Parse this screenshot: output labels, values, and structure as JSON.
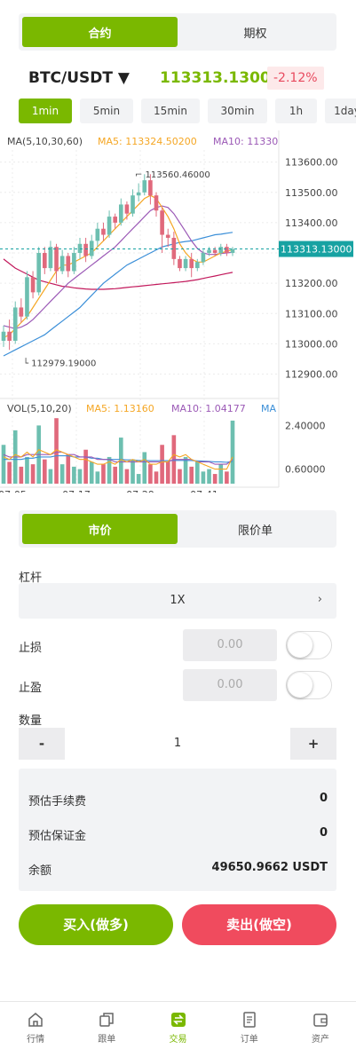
{
  "top_tabs": [
    "合约",
    "期权"
  ],
  "pair": {
    "symbol": "BTC/USDT ▼",
    "price": "113313.13000",
    "change": "-2.12%"
  },
  "timeframes": [
    "1min",
    "5min",
    "15min",
    "30min",
    "1h",
    "1day"
  ],
  "colors": {
    "accent": "#7ab800",
    "down": "#f04b5e",
    "up_candle": "#6dbfb0",
    "down_candle": "#e0697c",
    "ma5": "#f5a623",
    "ma10": "#9b59b6",
    "ma30": "#3b8fd8",
    "ma60": "#c2185b"
  },
  "chart_data": [
    {
      "type": "candlestick",
      "legend": {
        "label": "MA(5,10,30,60)",
        "ma5": "MA5: 113324.50200",
        "ma10": "MA10: 11330"
      },
      "y_ticks": [
        "113600.00",
        "113500.00",
        "113400.00",
        "113300.00",
        "113200.00",
        "113100.00",
        "113000.00",
        "112900.00"
      ],
      "ylim": [
        112840,
        113640
      ],
      "current_price_label": "113313.13000",
      "high_annotation": "113560.46000",
      "low_annotation": "112979.19000",
      "x_ticks": [
        "07:05",
        "07:17",
        "07:29",
        "07:41"
      ],
      "candles": [
        [
          113010,
          113040,
          112990,
          113060
        ],
        [
          113040,
          113010,
          112980,
          113080
        ],
        [
          113010,
          113120,
          113000,
          113140
        ],
        [
          113120,
          113090,
          113070,
          113150
        ],
        [
          113090,
          113220,
          113080,
          113240
        ],
        [
          113220,
          113170,
          113150,
          113240
        ],
        [
          113170,
          113300,
          113160,
          113320
        ],
        [
          113300,
          113250,
          113230,
          113320
        ],
        [
          113250,
          113320,
          113240,
          113340
        ],
        [
          113320,
          113240,
          113200,
          113330
        ],
        [
          113240,
          113290,
          113230,
          113310
        ],
        [
          113290,
          113240,
          113220,
          113300
        ],
        [
          113240,
          113300,
          113230,
          113320
        ],
        [
          113300,
          113330,
          113280,
          113350
        ],
        [
          113330,
          113290,
          113270,
          113350
        ],
        [
          113290,
          113340,
          113280,
          113360
        ],
        [
          113340,
          113380,
          113320,
          113400
        ],
        [
          113380,
          113360,
          113340,
          113400
        ],
        [
          113360,
          113420,
          113350,
          113440
        ],
        [
          113420,
          113400,
          113380,
          113430
        ],
        [
          113400,
          113460,
          113390,
          113480
        ],
        [
          113460,
          113430,
          113410,
          113470
        ],
        [
          113430,
          113490,
          113420,
          113510
        ],
        [
          113490,
          113500,
          113470,
          113530
        ],
        [
          113500,
          113540,
          113490,
          113560
        ],
        [
          113540,
          113490,
          113460,
          113560
        ],
        [
          113490,
          113440,
          113420,
          113500
        ],
        [
          113440,
          113360,
          113300,
          113450
        ],
        [
          113360,
          113350,
          113320,
          113380
        ],
        [
          113350,
          113280,
          113260,
          113370
        ],
        [
          113280,
          113250,
          113240,
          113290
        ],
        [
          113250,
          113280,
          113240,
          113290
        ],
        [
          113280,
          113250,
          113220,
          113300
        ],
        [
          113250,
          113270,
          113240,
          113280
        ],
        [
          113270,
          113300,
          113260,
          113310
        ],
        [
          113300,
          113310,
          113290,
          113320
        ],
        [
          113310,
          113300,
          113290,
          113320
        ],
        [
          113300,
          113320,
          113290,
          113330
        ],
        [
          113320,
          113300,
          113290,
          113330
        ],
        [
          113300,
          113313,
          113290,
          113320
        ]
      ],
      "ma5": [
        113020,
        113030,
        113050,
        113070,
        113090,
        113120,
        113150,
        113180,
        113210,
        113240,
        113260,
        113260,
        113270,
        113280,
        113290,
        113300,
        113320,
        113340,
        113360,
        113380,
        113400,
        113420,
        113440,
        113460,
        113480,
        113490,
        113480,
        113450,
        113420,
        113380,
        113330,
        113300,
        113280,
        113270,
        113270,
        113280,
        113290,
        113300,
        113305,
        113310
      ],
      "ma10": [
        113060,
        113055,
        113050,
        113055,
        113065,
        113080,
        113100,
        113120,
        113140,
        113160,
        113180,
        113200,
        113215,
        113230,
        113245,
        113260,
        113275,
        113290,
        113305,
        113320,
        113340,
        113360,
        113380,
        113400,
        113420,
        113440,
        113450,
        113455,
        113450,
        113430,
        113400,
        113370,
        113340,
        113315,
        113300,
        113295,
        113295,
        113298,
        113300,
        113302
      ],
      "ma30": [
        112960,
        112970,
        112980,
        112990,
        113000,
        113010,
        113020,
        113030,
        113045,
        113060,
        113075,
        113090,
        113105,
        113120,
        113140,
        113160,
        113180,
        113200,
        113215,
        113230,
        113245,
        113260,
        113270,
        113280,
        113290,
        113300,
        113310,
        113320,
        113325,
        113330,
        113335,
        113338,
        113340,
        113345,
        113350,
        113355,
        113360,
        113362,
        113365,
        113368
      ],
      "ma60": [
        113280,
        113265,
        113250,
        113240,
        113230,
        113220,
        113210,
        113205,
        113200,
        113195,
        113190,
        113188,
        113185,
        113183,
        113181,
        113180,
        113180,
        113180,
        113181,
        113182,
        113184,
        113186,
        113188,
        113190,
        113192,
        113194,
        113196,
        113198,
        113200,
        113202,
        113204,
        113206,
        113209,
        113212,
        113216,
        113220,
        113224,
        113228,
        113232,
        113236
      ]
    },
    {
      "type": "bar",
      "legend": {
        "label": "VOL(5,10,20)",
        "ma5": "MA5: 1.13160",
        "ma10": "MA10: 1.04177",
        "ma20": "MA"
      },
      "y_ticks": [
        "2.40000",
        "0.60000"
      ],
      "ylim": [
        0,
        3.0
      ],
      "volumes": [
        1.6,
        0.9,
        2.2,
        0.7,
        1.1,
        0.8,
        2.4,
        1.0,
        0.6,
        2.7,
        0.8,
        1.2,
        0.7,
        0.6,
        1.4,
        0.9,
        0.5,
        0.8,
        1.1,
        0.7,
        1.9,
        0.6,
        1.0,
        0.4,
        1.3,
        0.8,
        0.5,
        1.6,
        0.9,
        2.0,
        0.6,
        1.1,
        0.7,
        0.9,
        0.5,
        0.6,
        0.4,
        0.8,
        0.5,
        2.6
      ],
      "vol_ma5": [
        1.1,
        1.0,
        1.2,
        1.1,
        1.3,
        1.1,
        1.4,
        1.3,
        1.2,
        1.4,
        1.3,
        1.2,
        1.1,
        1.0,
        1.0,
        0.9,
        0.8,
        0.8,
        0.9,
        0.8,
        1.0,
        0.9,
        1.0,
        0.9,
        1.0,
        0.8,
        0.8,
        0.9,
        0.9,
        1.2,
        1.1,
        1.2,
        1.0,
        0.9,
        0.8,
        0.7,
        0.6,
        0.6,
        0.6,
        1.1
      ],
      "vol_ma10": [
        1.2,
        1.1,
        1.1,
        1.1,
        1.2,
        1.2,
        1.2,
        1.2,
        1.2,
        1.3,
        1.3,
        1.2,
        1.2,
        1.1,
        1.1,
        1.1,
        1.0,
        1.0,
        1.0,
        0.9,
        0.9,
        0.9,
        0.9,
        0.9,
        0.9,
        0.9,
        0.9,
        0.9,
        0.9,
        1.0,
        1.0,
        1.0,
        1.0,
        0.9,
        0.9,
        0.9,
        0.8,
        0.8,
        0.8,
        1.0
      ],
      "vol_ma20": [
        1.0,
        1.0,
        1.0,
        1.0,
        1.05,
        1.05,
        1.1,
        1.1,
        1.1,
        1.15,
        1.15,
        1.15,
        1.1,
        1.1,
        1.1,
        1.05,
        1.05,
        1.0,
        1.0,
        1.0,
        1.0,
        0.98,
        0.98,
        0.96,
        0.96,
        0.95,
        0.95,
        0.95,
        0.95,
        0.96,
        0.96,
        0.96,
        0.95,
        0.94,
        0.93,
        0.92,
        0.9,
        0.9,
        0.88,
        0.92
      ]
    }
  ],
  "order_tabs": [
    "市价",
    "限价单"
  ],
  "form": {
    "leverage_label": "杠杆",
    "leverage_value": "1X",
    "leverage_chevron": "›",
    "stop_loss_label": "止损",
    "stop_loss_value": "0.00",
    "take_profit_label": "止盈",
    "take_profit_value": "0.00",
    "quantity_label": "数量",
    "minus": "-",
    "quantity": "1",
    "plus": "+"
  },
  "summary": {
    "fee_label": "预估手续费",
    "fee_value": "0",
    "margin_label": "预估保证金",
    "margin_value": "0",
    "balance_label": "余额",
    "balance_value": "49650.9662 USDT"
  },
  "actions": {
    "buy": "买入(做多)",
    "sell": "卖出(做空)"
  },
  "tabbar": [
    {
      "label": "行情",
      "icon": "home-icon"
    },
    {
      "label": "跟单",
      "icon": "copy-icon"
    },
    {
      "label": "交易",
      "icon": "swap-icon"
    },
    {
      "label": "订单",
      "icon": "document-icon"
    },
    {
      "label": "资产",
      "icon": "wallet-icon"
    }
  ]
}
